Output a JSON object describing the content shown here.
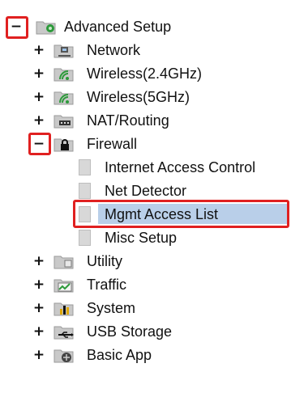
{
  "tree": {
    "root": {
      "label": "Advanced Setup",
      "toggle": "−"
    },
    "branches": [
      {
        "id": "network",
        "label": "Network",
        "toggle": "+",
        "icon": "network-folder-icon"
      },
      {
        "id": "wireless24",
        "label": "Wireless(2.4GHz)",
        "toggle": "+",
        "icon": "wireless-folder-icon"
      },
      {
        "id": "wireless5",
        "label": "Wireless(5GHz)",
        "toggle": "+",
        "icon": "wireless-folder-icon"
      },
      {
        "id": "nat",
        "label": "NAT/Routing",
        "toggle": "+",
        "icon": "router-folder-icon"
      },
      {
        "id": "firewall",
        "label": "Firewall",
        "toggle": "−",
        "icon": "lock-folder-icon"
      },
      {
        "id": "utility",
        "label": "Utility",
        "toggle": "+",
        "icon": "utility-folder-icon"
      },
      {
        "id": "traffic",
        "label": "Traffic",
        "toggle": "+",
        "icon": "chart-folder-icon"
      },
      {
        "id": "system",
        "label": "System",
        "toggle": "+",
        "icon": "bar-chart-folder-icon"
      },
      {
        "id": "usb",
        "label": "USB Storage",
        "toggle": "+",
        "icon": "usb-folder-icon"
      },
      {
        "id": "basicapp",
        "label": "Basic App",
        "toggle": "+",
        "icon": "app-folder-icon"
      }
    ],
    "firewall_children": [
      {
        "label": "Internet Access Control"
      },
      {
        "label": "Net Detector"
      },
      {
        "label": "Mgmt Access List",
        "selected": true
      },
      {
        "label": "Misc Setup"
      }
    ]
  },
  "colors": {
    "highlight_box": "#e02020",
    "selected_bg": "#b9cfe9",
    "folder": "#c9c9c9",
    "accent_green": "#2c9a3a"
  }
}
